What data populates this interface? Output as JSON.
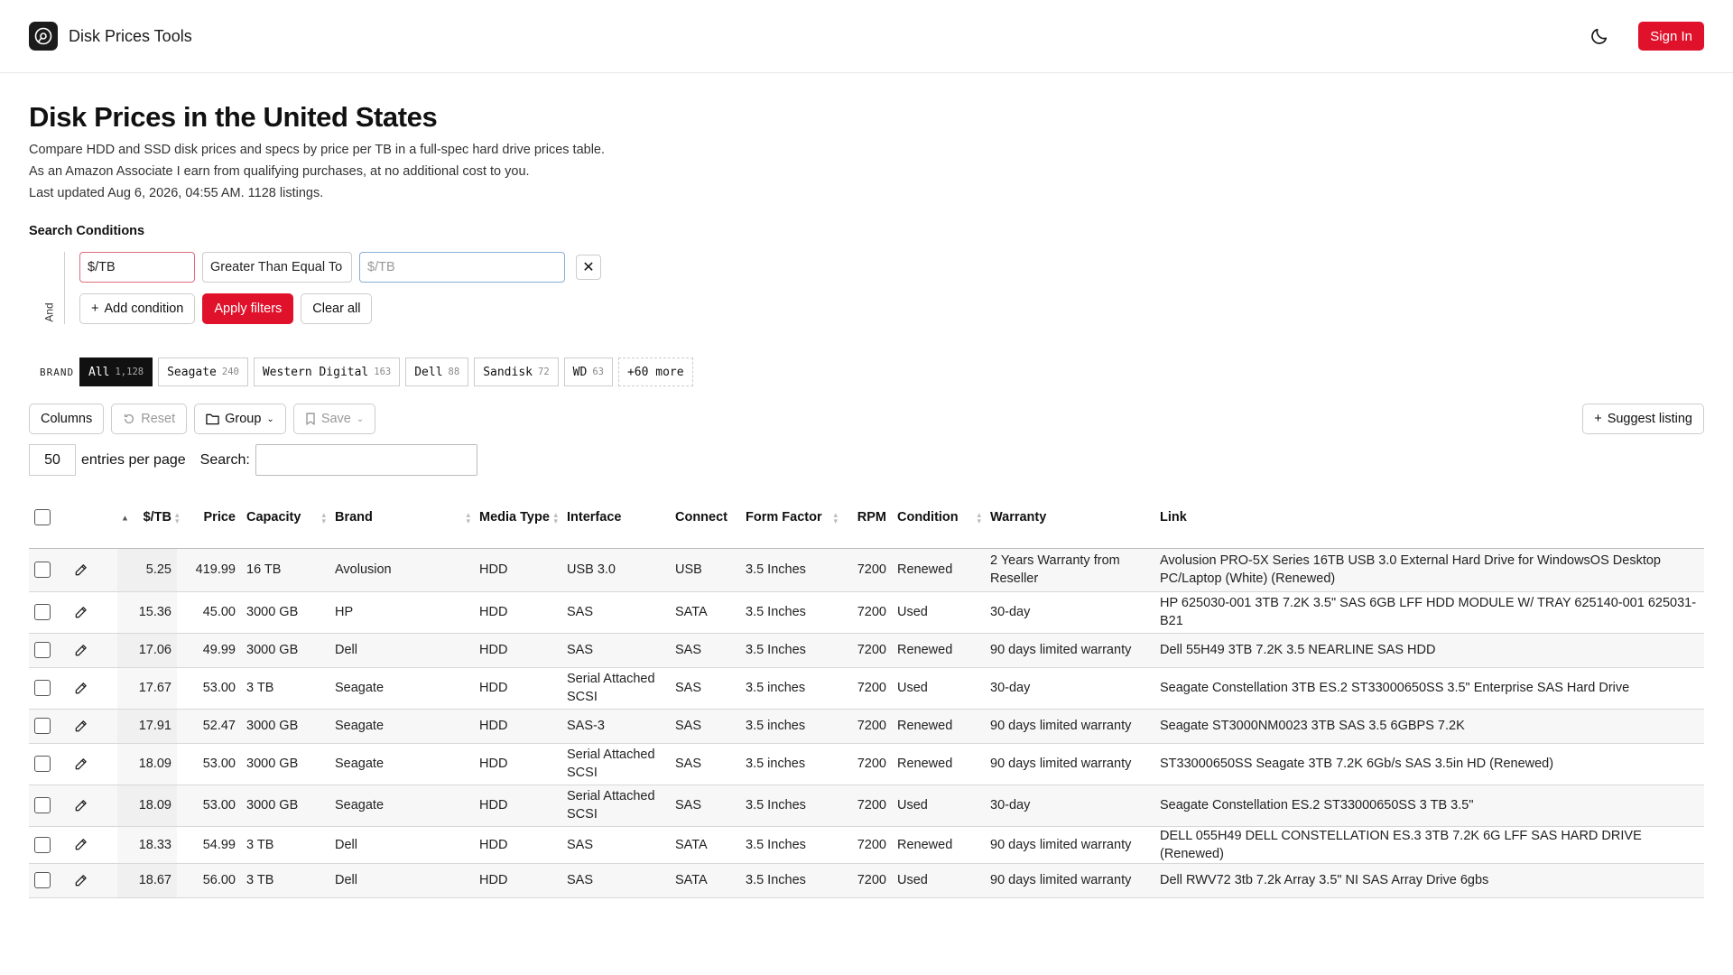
{
  "app": {
    "name": "Disk Prices Tools",
    "sign_in": "Sign In"
  },
  "page": {
    "title": "Disk Prices in the United States",
    "desc1": "Compare HDD and SSD disk prices and specs by price per TB in a full-spec hard drive prices table.",
    "desc2": "As an Amazon Associate I earn from qualifying purchases, at no additional cost to you.",
    "desc3": "Last updated Aug 6, 2026, 04:55 AM. 1128 listings."
  },
  "search": {
    "title": "Search Conditions",
    "and_label": "And",
    "field": "$/TB",
    "operator": "Greater Than Equal To",
    "value_placeholder": "$/TB",
    "add_condition": "Add condition",
    "apply": "Apply filters",
    "clear": "Clear all"
  },
  "brand_filter": {
    "label": "BRAND",
    "chips": [
      {
        "name": "All",
        "count": "1,128"
      },
      {
        "name": "Seagate",
        "count": "240"
      },
      {
        "name": "Western Digital",
        "count": "163"
      },
      {
        "name": "Dell",
        "count": "88"
      },
      {
        "name": "Sandisk",
        "count": "72"
      },
      {
        "name": "WD",
        "count": "63"
      }
    ],
    "more": "+60 more"
  },
  "toolbar": {
    "columns": "Columns",
    "reset": "Reset",
    "group": "Group",
    "save": "Save",
    "suggest": "Suggest listing"
  },
  "table_controls": {
    "per_page": "50",
    "entries_label": "entries per page",
    "search_label": "Search:"
  },
  "table": {
    "headers": {
      "per_tb": "$/TB",
      "price": "Price",
      "capacity": "Capacity",
      "brand": "Brand",
      "media_type": "Media Type",
      "interface": "Interface",
      "connect": "Connect",
      "form_factor": "Form Factor",
      "rpm": "RPM",
      "condition": "Condition",
      "warranty": "Warranty",
      "link": "Link"
    },
    "rows": [
      {
        "per_tb": "5.25",
        "price": "419.99",
        "capacity": "16 TB",
        "brand": "Avolusion",
        "media": "HDD",
        "iface": "USB 3.0",
        "connect": "USB",
        "form": "3.5 Inches",
        "rpm": "7200",
        "condition": "Renewed",
        "warranty": "2 Years Warranty from Reseller",
        "link": "Avolusion PRO-5X Series 16TB USB 3.0 External Hard Drive for WindowsOS Desktop PC/Laptop (White) (Renewed)"
      },
      {
        "per_tb": "15.36",
        "price": "45.00",
        "capacity": "3000 GB",
        "brand": "HP",
        "media": "HDD",
        "iface": "SAS",
        "connect": "SATA",
        "form": "3.5 Inches",
        "rpm": "7200",
        "condition": "Used",
        "warranty": "30-day",
        "link": "HP 625030-001 3TB 7.2K 3.5\" SAS 6GB LFF HDD MODULE W/ TRAY 625140-001 625031-B21"
      },
      {
        "per_tb": "17.06",
        "price": "49.99",
        "capacity": "3000 GB",
        "brand": "Dell",
        "media": "HDD",
        "iface": "SAS",
        "connect": "SAS",
        "form": "3.5 Inches",
        "rpm": "7200",
        "condition": "Renewed",
        "warranty": "90 days limited warranty",
        "link": "Dell 55H49 3TB 7.2K 3.5 NEARLINE SAS HDD"
      },
      {
        "per_tb": "17.67",
        "price": "53.00",
        "capacity": "3 TB",
        "brand": "Seagate",
        "media": "HDD",
        "iface": "Serial Attached SCSI",
        "connect": "SAS",
        "form": "3.5 inches",
        "rpm": "7200",
        "condition": "Used",
        "warranty": "30-day",
        "link": "Seagate Constellation 3TB ES.2 ST33000650SS 3.5\" Enterprise SAS Hard Drive"
      },
      {
        "per_tb": "17.91",
        "price": "52.47",
        "capacity": "3000 GB",
        "brand": "Seagate",
        "media": "HDD",
        "iface": "SAS-3",
        "connect": "SAS",
        "form": "3.5 inches",
        "rpm": "7200",
        "condition": "Renewed",
        "warranty": "90 days limited warranty",
        "link": "Seagate ST3000NM0023 3TB SAS 3.5 6GBPS 7.2K"
      },
      {
        "per_tb": "18.09",
        "price": "53.00",
        "capacity": "3000 GB",
        "brand": "Seagate",
        "media": "HDD",
        "iface": "Serial Attached SCSI",
        "connect": "SAS",
        "form": "3.5 inches",
        "rpm": "7200",
        "condition": "Renewed",
        "warranty": "90 days limited warranty",
        "link": "ST33000650SS Seagate 3TB 7.2K 6Gb/s SAS 3.5in HD (Renewed)"
      },
      {
        "per_tb": "18.09",
        "price": "53.00",
        "capacity": "3000 GB",
        "brand": "Seagate",
        "media": "HDD",
        "iface": "Serial Attached SCSI",
        "connect": "SAS",
        "form": "3.5 Inches",
        "rpm": "7200",
        "condition": "Used",
        "warranty": "30-day",
        "link": "Seagate Constellation ES.2 ST33000650SS 3 TB 3.5\""
      },
      {
        "per_tb": "18.33",
        "price": "54.99",
        "capacity": "3 TB",
        "brand": "Dell",
        "media": "HDD",
        "iface": "SAS",
        "connect": "SATA",
        "form": "3.5 Inches",
        "rpm": "7200",
        "condition": "Renewed",
        "warranty": "90 days limited warranty",
        "link": "DELL 055H49 DELL CONSTELLATION ES.3 3TB 7.2K 6G LFF SAS HARD DRIVE (Renewed)"
      },
      {
        "per_tb": "18.67",
        "price": "56.00",
        "capacity": "3 TB",
        "brand": "Dell",
        "media": "HDD",
        "iface": "SAS",
        "connect": "SATA",
        "form": "3.5 Inches",
        "rpm": "7200",
        "condition": "Used",
        "warranty": "90 days limited warranty",
        "link": "Dell RWV72 3tb 7.2k Array 3.5\" NI SAS Array Drive 6gbs"
      }
    ]
  }
}
